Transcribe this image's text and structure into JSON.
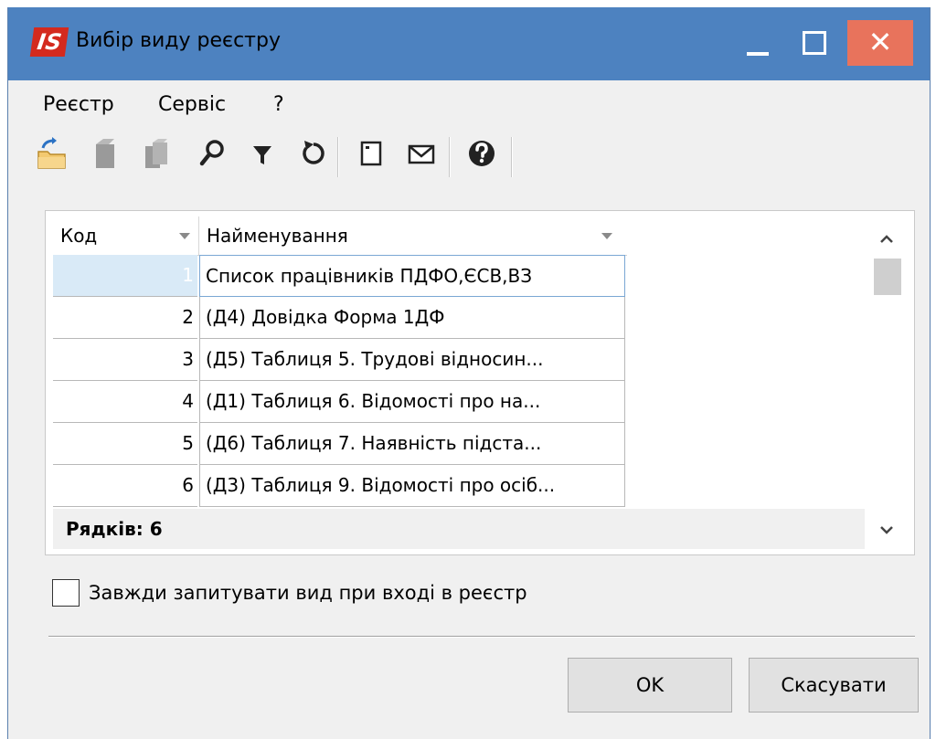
{
  "window": {
    "app_logo": "IS",
    "title": "Вибір виду реєстру",
    "close_glyph": "✕"
  },
  "menu": [
    "Реєстр",
    "Сервіс",
    "?"
  ],
  "toolbar": {
    "icons": [
      "open-folder-icon",
      "bookmark-icon",
      "bookmarks-icon",
      "search-icon",
      "filter-icon",
      "refresh-icon",
      "details-icon",
      "mail-icon",
      "help-icon"
    ]
  },
  "grid": {
    "columns": {
      "code": "Код",
      "name": "Найменування"
    },
    "rows": [
      {
        "code": "1",
        "name": "Список працівників ПДФО,ЄСВ,ВЗ"
      },
      {
        "code": "2",
        "name": "(Д4) Довідка Форма 1ДФ"
      },
      {
        "code": "3",
        "name": "(Д5) Таблиця 5. Трудові відносин..."
      },
      {
        "code": "4",
        "name": "(Д1) Таблиця 6. Відомості про на..."
      },
      {
        "code": "5",
        "name": "(Д6) Таблиця 7. Наявність підста..."
      },
      {
        "code": "6",
        "name": "(Д3) Таблиця 9. Відомості про осіб..."
      }
    ],
    "selected_row": 0,
    "footer": "Рядків: 6"
  },
  "checkbox": {
    "label": "Завжди запитувати вид при вході в реєстр",
    "checked": false
  },
  "buttons": {
    "ok": "OK",
    "cancel": "Скасувати"
  },
  "colors": {
    "titlebar": "#4d82c0",
    "close": "#e8735c",
    "logo": "#d42a1e",
    "selection": "#d9eaf7"
  }
}
